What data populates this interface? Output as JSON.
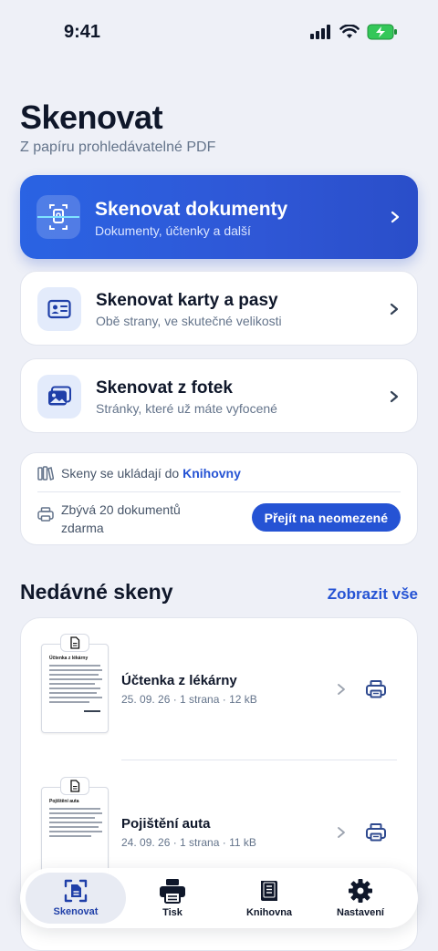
{
  "status": {
    "time": "9:41"
  },
  "header": {
    "title": "Skenovat",
    "subtitle": "Z papíru prohledávatelné PDF"
  },
  "actions": [
    {
      "title": "Skenovat dokumenty",
      "subtitle": "Dokumenty, účtenky a další",
      "icon": "scan-document-icon",
      "primary": true
    },
    {
      "title": "Skenovat karty a pasy",
      "subtitle": "Obě strany, ve skutečné velikosti",
      "icon": "id-card-icon"
    },
    {
      "title": "Skenovat z fotek",
      "subtitle": "Stránky, které už máte vyfocené",
      "icon": "photos-icon"
    }
  ],
  "info": {
    "storage_text": "Skeny se ukládají do ",
    "storage_link": "Knihovny",
    "quota_line1": "Zbývá 20 dokumentů",
    "quota_line2": "zdarma",
    "upgrade_label": "Přejít na neomezené"
  },
  "recent": {
    "title": "Nedávné skeny",
    "see_all": "Zobrazit vše",
    "items": [
      {
        "name": "Účtenka z lékárny",
        "meta": "25. 09. 26 · 1 strana · 12 kB",
        "thumb_heading": "Účtenka z lékárny"
      },
      {
        "name": "Pojištění auta",
        "meta": "24. 09. 26 · 1 strana · 11 kB",
        "thumb_heading": "Pojištění auta"
      }
    ]
  },
  "tabbar": {
    "items": [
      {
        "label": "Skenovat",
        "icon": "scan-icon",
        "active": true
      },
      {
        "label": "Tisk",
        "icon": "printer-icon"
      },
      {
        "label": "Knihovna",
        "icon": "library-icon"
      },
      {
        "label": "Nastavení",
        "icon": "gear-icon"
      }
    ]
  },
  "colors": {
    "accent": "#2553d4",
    "background": "#eef0f7"
  }
}
